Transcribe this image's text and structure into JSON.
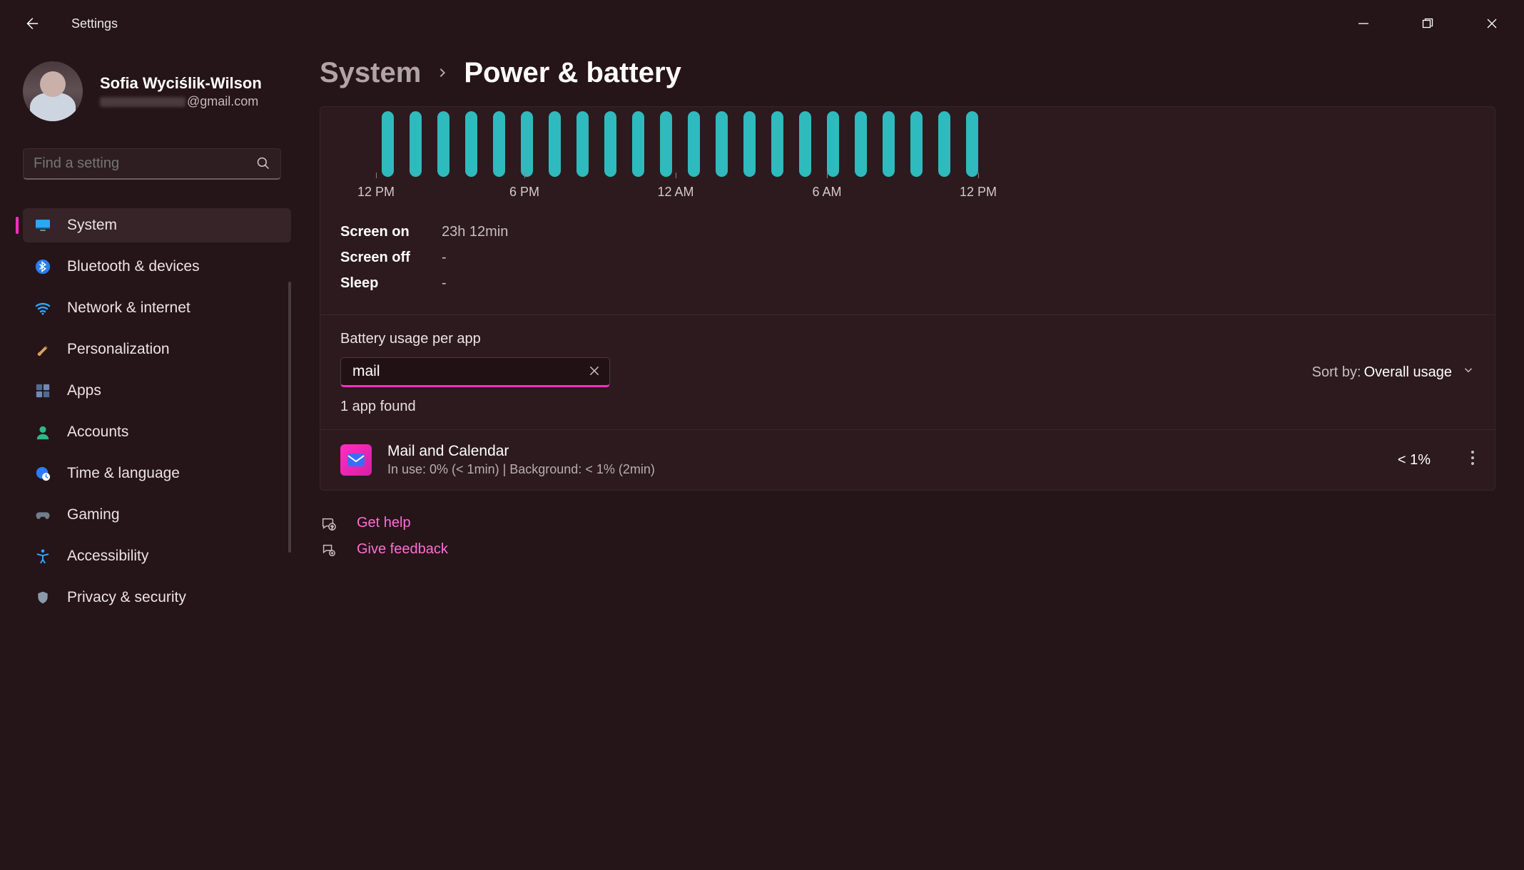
{
  "app_title": "Settings",
  "profile": {
    "name": "Sofia Wyciślik-Wilson",
    "email_suffix": "@gmail.com"
  },
  "search_placeholder": "Find a setting",
  "nav": [
    {
      "id": "system",
      "label": "System",
      "active": true
    },
    {
      "id": "bluetooth",
      "label": "Bluetooth & devices",
      "active": false
    },
    {
      "id": "network",
      "label": "Network & internet",
      "active": false
    },
    {
      "id": "personal",
      "label": "Personalization",
      "active": false
    },
    {
      "id": "apps",
      "label": "Apps",
      "active": false
    },
    {
      "id": "accounts",
      "label": "Accounts",
      "active": false
    },
    {
      "id": "time",
      "label": "Time & language",
      "active": false
    },
    {
      "id": "gaming",
      "label": "Gaming",
      "active": false
    },
    {
      "id": "accessibility",
      "label": "Accessibility",
      "active": false
    },
    {
      "id": "privacy",
      "label": "Privacy & security",
      "active": false
    }
  ],
  "breadcrumb": {
    "parent": "System",
    "current": "Power & battery"
  },
  "chart_data": {
    "type": "bar",
    "categories": [
      "12 PM",
      "6 PM",
      "12 AM",
      "6 AM",
      "12 PM"
    ],
    "values": [
      100,
      100,
      100,
      100,
      100,
      100,
      100,
      100,
      100,
      100,
      100,
      100,
      100,
      100,
      100,
      100,
      100,
      100,
      100,
      100,
      100,
      100
    ],
    "title": "",
    "xlabel": "",
    "ylabel": "",
    "ylim": [
      0,
      100
    ]
  },
  "stats": {
    "screen_on_label": "Screen on",
    "screen_on_value": "23h 12min",
    "screen_off_label": "Screen off",
    "screen_off_value": "-",
    "sleep_label": "Sleep",
    "sleep_value": "-"
  },
  "per_app": {
    "section_title": "Battery usage per app",
    "search_value": "mail",
    "found_text": "1 app found",
    "sort_label": "Sort by:",
    "sort_value": "Overall usage"
  },
  "apps": [
    {
      "name": "Mail and Calendar",
      "sub": "In use: 0% (< 1min) | Background: < 1% (2min)",
      "pct": "< 1%"
    }
  ],
  "help": {
    "get_help": "Get help",
    "feedback": "Give feedback"
  }
}
